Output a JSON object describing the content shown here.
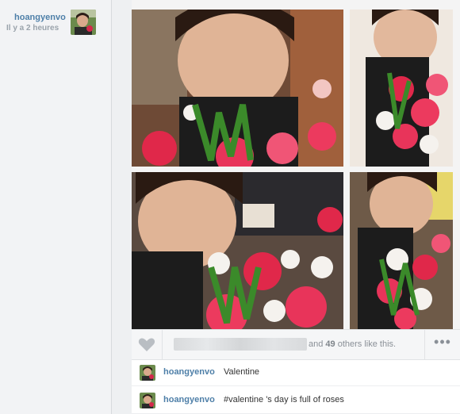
{
  "user": {
    "username": "hoangyenvo",
    "timestamp": "Il y a 2 heures"
  },
  "post": {
    "likes_count": "49",
    "likes_suffix": " others like this.",
    "likes_prefix": "and "
  },
  "comments": [
    {
      "username": "hoangyenvo",
      "text": "Valentine"
    },
    {
      "username": "hoangyenvo",
      "text": "#valentine 's day is full of roses"
    }
  ],
  "icons": {
    "like": "heart-icon",
    "more": "more-options-icon"
  },
  "colors": {
    "link": "#4e7fa8",
    "muted": "#9aa3ab",
    "rose": "#e0284a"
  }
}
